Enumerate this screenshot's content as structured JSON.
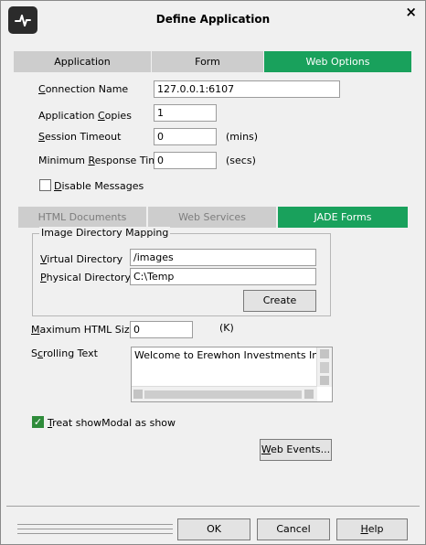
{
  "window": {
    "title": "Define Application",
    "close_glyph": "×"
  },
  "main_tabs": [
    {
      "label": "Application",
      "selected": false
    },
    {
      "label": "Form",
      "selected": false
    },
    {
      "label": "Web Options",
      "selected": true
    }
  ],
  "connection": {
    "name_label_pre": "",
    "name_label_ul": "C",
    "name_label_post": "onnection Name",
    "name_value": "127.0.0.1:6107",
    "copies_label_pre": "Application ",
    "copies_label_ul": "C",
    "copies_label_post": "opies",
    "copies_value": "1",
    "timeout_label_pre": "",
    "timeout_label_ul": "S",
    "timeout_label_post": "ession Timeout",
    "timeout_value": "0",
    "timeout_unit": "(mins)",
    "min_resp_label_pre": "Minimum ",
    "min_resp_label_ul": "R",
    "min_resp_label_post": "esponse Time",
    "min_resp_value": "0",
    "min_resp_unit": "(secs)",
    "disable_label_pre": "",
    "disable_label_ul": "D",
    "disable_label_post": "isable Messages",
    "disable_checked": false
  },
  "sub_tabs": [
    {
      "label": "HTML Documents",
      "state": "dim"
    },
    {
      "label": "Web Services",
      "state": "dim"
    },
    {
      "label": "JADE Forms",
      "state": "selected"
    }
  ],
  "image_mapping": {
    "group_title": "Image Directory Mapping",
    "virtual_label_pre": "",
    "virtual_label_ul": "V",
    "virtual_label_post": "irtual Directory",
    "virtual_value": "/images",
    "physical_label_pre": "",
    "physical_label_ul": "P",
    "physical_label_post": "hysical Directory",
    "physical_value": "C:\\Temp",
    "create_label": "Create"
  },
  "html_size": {
    "label_pre": "",
    "label_ul": "M",
    "label_post": "aximum HTML Size",
    "value": "0",
    "unit": "(K)"
  },
  "scrolling": {
    "label_pre": "S",
    "label_ul": "c",
    "label_post": "rolling Text",
    "value": "Welcome to Erewhon Investments Inc."
  },
  "modal_check": {
    "label_pre": "",
    "label_ul": "T",
    "label_post": "reat showModal as show",
    "checked": true,
    "check_glyph": "✓"
  },
  "web_events": {
    "label_pre": "",
    "label_ul": "W",
    "label_post": "eb Events..."
  },
  "footer": {
    "ok_label": "OK",
    "cancel_label": "Cancel",
    "help_label_pre": "",
    "help_label_ul": "H",
    "help_label_post": "elp"
  },
  "icons": {
    "app_icon": "waveform-logo-icon",
    "close_icon": "close-icon"
  },
  "colors": {
    "accent_tab": "#19a15c",
    "inactive_tab": "#cdcdcd",
    "checkbox_checked": "#2e8b3a"
  }
}
